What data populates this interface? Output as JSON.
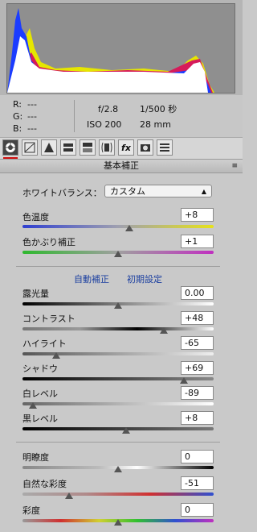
{
  "histogram": {
    "shadow_clip": "triangle-up-icon",
    "highlight_clip": "triangle-up-icon"
  },
  "rgb": [
    {
      "label": "R:",
      "value": "---"
    },
    {
      "label": "G:",
      "value": "---"
    },
    {
      "label": "B:",
      "value": "---"
    }
  ],
  "exif": {
    "aperture": "f/2.8",
    "shutter": "1/500 秒",
    "iso": "ISO 200",
    "focal": "28 mm"
  },
  "panel": {
    "title": "基本補正",
    "menu_icon": "≡"
  },
  "white_balance": {
    "label": "ホワイトバランス：",
    "value": "カスタム"
  },
  "links": {
    "auto": "自動補正",
    "default": "初期設定"
  },
  "sliders": {
    "temperature": {
      "label": "色温度",
      "value": "+8",
      "pos": 0.56
    },
    "tint": {
      "label": "色かぶり補正",
      "value": "+1",
      "pos": 0.5
    },
    "exposure": {
      "label": "露光量",
      "value": "0.00",
      "pos": 0.5
    },
    "contrast": {
      "label": "コントラスト",
      "value": "+48",
      "pos": 0.74
    },
    "highlights": {
      "label": "ハイライト",
      "value": "-65",
      "pos": 0.175
    },
    "shadows": {
      "label": "シャドウ",
      "value": "+69",
      "pos": 0.845
    },
    "whites": {
      "label": "白レベル",
      "value": "-89",
      "pos": 0.055
    },
    "blacks": {
      "label": "黒レベル",
      "value": "+8",
      "pos": 0.54
    },
    "clarity": {
      "label": "明瞭度",
      "value": "0",
      "pos": 0.5
    },
    "vibrance": {
      "label": "自然な彩度",
      "value": "-51",
      "pos": 0.245
    },
    "saturation": {
      "label": "彩度",
      "value": "0",
      "pos": 0.5
    }
  }
}
